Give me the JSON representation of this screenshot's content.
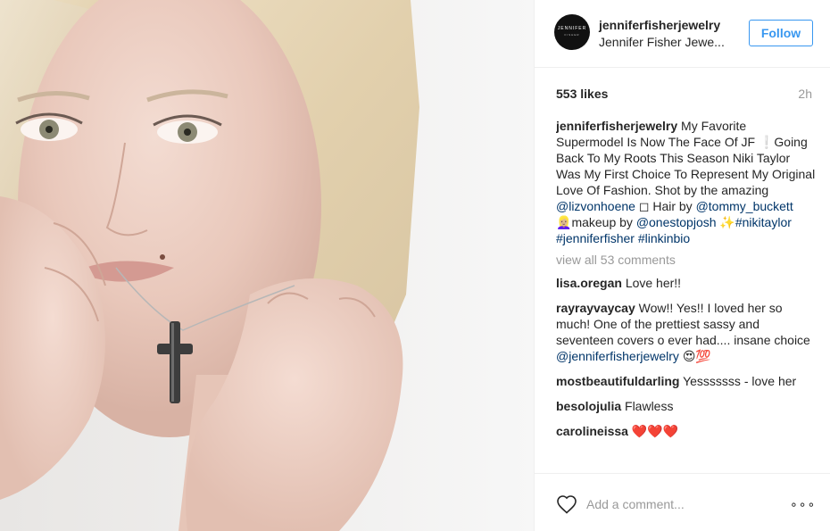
{
  "post": {
    "username": "jenniferfisherjewelry",
    "full_name": "Jennifer Fisher Jewe...",
    "avatar_text": [
      "JENNIFER",
      "FISHER"
    ],
    "follow_label": "Follow",
    "likes": "553 likes",
    "time": "2h",
    "caption": {
      "username": "jenniferfisherjewelry",
      "text_1": " My Favorite Supermodel Is Now The Face Of JF ",
      "emoji_1": "❕",
      "text_2": "Going Back To My Roots This Season Niki Taylor Was My First Choice To Represent My Original Love Of Fashion. Shot by the amazing ",
      "mention_1": "@lizvonhoene",
      "text_3": " ◻ Hair by ",
      "mention_2": "@tommy_buckett",
      "emoji_2": " 👱🏼‍♀️",
      "text_4": "makeup by ",
      "mention_3": "@onestopjosh",
      "emoji_3": " ✨",
      "hashtag_1": "#nikitaylor",
      "hashtag_2": "#jenniferfisher",
      "hashtag_3": "#linkinbio"
    },
    "view_all": "view all 53 comments",
    "comments": [
      {
        "user": "lisa.oregan",
        "text": "Love her!!"
      },
      {
        "user": "rayrayvaycay",
        "text": "Wow!! Yes!! I loved her so much! One of the prettiest sassy and seventeen covers o ever had.... insane choice ",
        "mention": "@jenniferfisherjewelry",
        "emoji": " 😍💯"
      },
      {
        "user": "mostbeautifuldarling",
        "text": "Yesssssss - love her"
      },
      {
        "user": "besolojulia",
        "text": "Flawless"
      },
      {
        "user": "carolineissa",
        "text": "❤️❤️❤️"
      }
    ],
    "add_comment_placeholder": "Add a comment...",
    "more_glyph": "∘∘∘"
  },
  "icons": {
    "like": "heart-outline-icon",
    "more": "more-options-icon"
  },
  "colors": {
    "link": "#003569",
    "follow": "#3897f0",
    "muted": "#999999",
    "text": "#262626"
  }
}
